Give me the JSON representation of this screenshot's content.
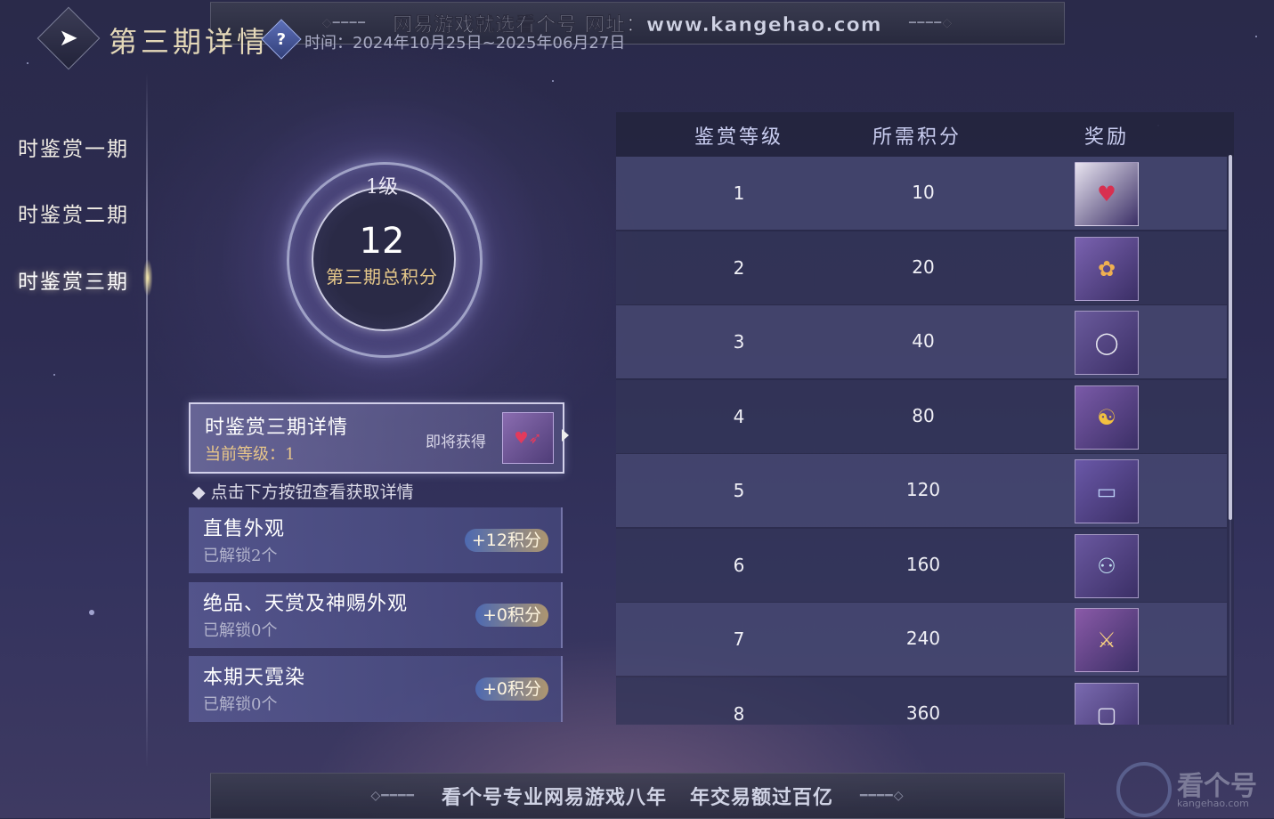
{
  "watermark_top": "网易游戏就选看个号   网址：www.kangehao.com",
  "watermark_bottom": [
    "看个号专业网易游戏八年",
    "年交易额过百亿"
  ],
  "header": {
    "back_icon": "back-arrow-icon",
    "title": "第三期详情",
    "help_icon": "question-icon",
    "help_glyph": "?",
    "time": "时间：2024年10月25日~2025年06月27日"
  },
  "sidebar": {
    "items": [
      {
        "label": "时鉴赏一期",
        "active": false
      },
      {
        "label": "时鉴赏二期",
        "active": false
      },
      {
        "label": "时鉴赏三期",
        "active": true
      }
    ]
  },
  "score_ring": {
    "level": "1级",
    "score": "12",
    "label": "第三期总积分"
  },
  "details_card": {
    "title": "时鉴赏三期详情",
    "current_level": "当前等级：1",
    "soon_label": "即将获得",
    "thumb_icon": "hearts-arrow-icon",
    "thumb_glyph": "♥➶"
  },
  "hint": "◆ 点击下方按钮查看获取详情",
  "sources": [
    {
      "title": "直售外观",
      "sub": "已解锁2个",
      "badge": "+12积分"
    },
    {
      "title": "绝品、天赏及神赐外观",
      "sub": "已解锁0个",
      "badge": "+0积分"
    },
    {
      "title": "本期天霓染",
      "sub": "已解锁0个",
      "badge": "+0积分"
    }
  ],
  "table": {
    "headers": [
      "鉴赏等级",
      "所需积分",
      "奖励"
    ],
    "rows": [
      {
        "level": "1",
        "points": "10",
        "reward_icon": "hearts-arrow-icon",
        "glyph": "♥",
        "bg": "#e8e4f0",
        "fg": "#d83050"
      },
      {
        "level": "2",
        "points": "20",
        "reward_icon": "charm-pendant-icon",
        "glyph": "✿",
        "bg": "#7a62b0",
        "fg": "#f0b050"
      },
      {
        "level": "3",
        "points": "40",
        "reward_icon": "ring-frame-icon",
        "glyph": "◯",
        "bg": "#6a5a9c",
        "fg": "#e8e8f0"
      },
      {
        "level": "4",
        "points": "80",
        "reward_icon": "yin-yang-icon",
        "glyph": "☯",
        "bg": "#7a5aa8",
        "fg": "#f2c040"
      },
      {
        "level": "5",
        "points": "120",
        "reward_icon": "scroll-card-icon",
        "glyph": "▭",
        "bg": "#6a58a8",
        "fg": "#bcd0f8"
      },
      {
        "level": "6",
        "points": "160",
        "reward_icon": "couple-figures-icon",
        "glyph": "⚇",
        "bg": "#6a58a0",
        "fg": "#bfe0f0"
      },
      {
        "level": "7",
        "points": "240",
        "reward_icon": "warrior-pose-icon",
        "glyph": "⚔",
        "bg": "#8a5aa8",
        "fg": "#f8d080"
      },
      {
        "level": "8",
        "points": "360",
        "reward_icon": "mystery-box-icon",
        "glyph": "▢",
        "bg": "#7a6ab0",
        "fg": "#e0e0f0"
      }
    ]
  },
  "logo": {
    "name": "看个号",
    "sub": "kangehao.com"
  }
}
